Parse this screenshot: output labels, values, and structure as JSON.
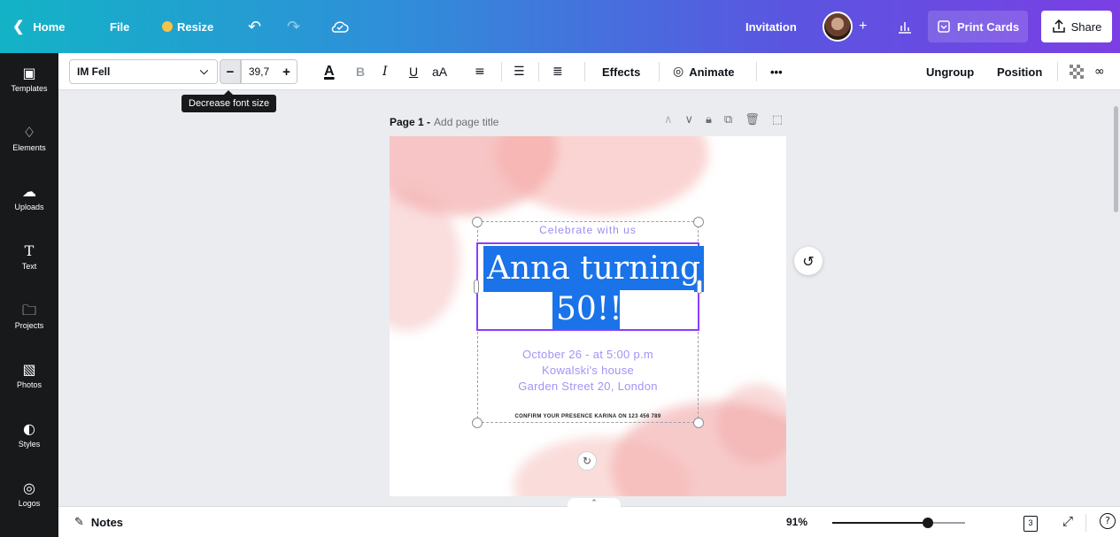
{
  "topbar": {
    "back_icon": "chevron-left-icon",
    "home": "Home",
    "file": "File",
    "resize": "Resize",
    "undo_icon": "undo-icon",
    "redo_icon": "redo-icon",
    "cloud_icon": "cloud-check-icon",
    "doc_title": "Invitation",
    "add_icon": "plus-icon",
    "stats_icon": "bar-chart-icon",
    "print": "Print Cards",
    "share": "Share",
    "gradient_start": "#13b3c6",
    "gradient_end": "#7b3fe4"
  },
  "sidebar": {
    "items": [
      {
        "label": "Templates",
        "icon": "templates-icon"
      },
      {
        "label": "Elements",
        "icon": "elements-icon"
      },
      {
        "label": "Uploads",
        "icon": "upload-cloud-icon"
      },
      {
        "label": "Text",
        "icon": "text-icon"
      },
      {
        "label": "Projects",
        "icon": "folder-icon"
      },
      {
        "label": "Photos",
        "icon": "photos-icon"
      },
      {
        "label": "Styles",
        "icon": "palette-icon"
      },
      {
        "label": "Logos",
        "icon": "logo-icon"
      }
    ]
  },
  "toolbar": {
    "font_name": "IM Fell",
    "font_size": "39,7",
    "effects": "Effects",
    "animate": "Animate",
    "more": "•••",
    "ungroup": "Ungroup",
    "position": "Position",
    "text_color_glyph": "A",
    "bold_glyph": "B",
    "italic_glyph": "I",
    "underline_glyph": "U",
    "case_glyph": "aA"
  },
  "tooltip": "Decrease font size",
  "page": {
    "label": "Page 1 -",
    "title_placeholder": "Add page title"
  },
  "design": {
    "celebrate": "Celebrate with us",
    "headline_line1": "Anna turning",
    "headline_line2": "50!!!",
    "detail1": "October 26 - at 5:00 p.m",
    "detail2": "Kowalski's house",
    "detail3": "Garden Street 20, London",
    "confirm": "CONFIRM YOUR PRESENCE KARINA ON 123 456 789",
    "accent": "#a493f5",
    "selection_color": "#8b3dff",
    "highlight_color": "#1a73e8"
  },
  "bottombar": {
    "notes": "Notes",
    "zoom": "91%",
    "zoom_level": 0.72,
    "pages_count": "3",
    "expand_icon": "expand-icon",
    "help_icon": "help-icon"
  }
}
